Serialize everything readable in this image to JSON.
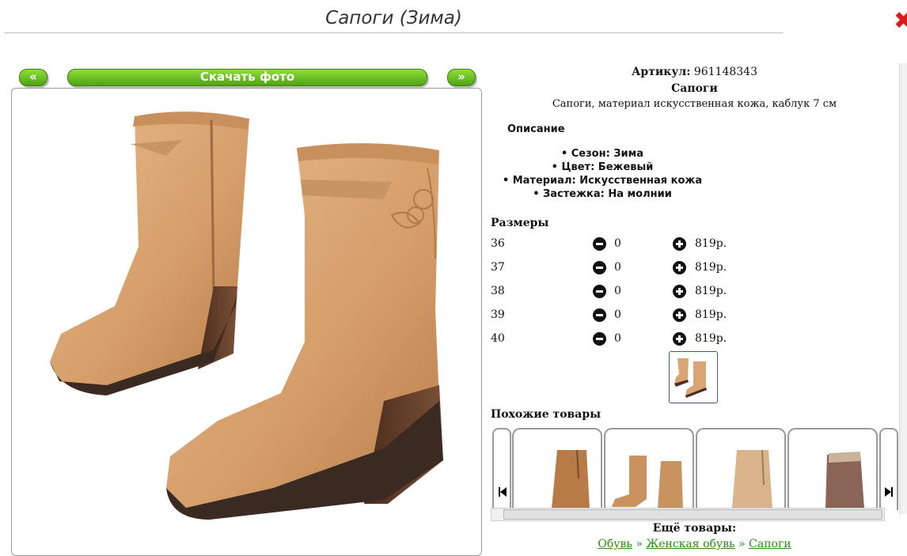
{
  "page": {
    "title": "Сапоги (Зима)"
  },
  "gallery": {
    "prev_label": "«",
    "download_label": "Скачать фото",
    "next_label": "»"
  },
  "product": {
    "article_label": "Артикул:",
    "article_value": "961148343",
    "name": "Сапоги",
    "short_desc": "Сапоги, материал искусственная кожа, каблук 7 см",
    "description_heading": "Описание",
    "features": [
      "• Сезон: Зима",
      "• Цвет: Бежевый",
      "• Материал: Искусственная кожа",
      "• Застежка: На молнии"
    ]
  },
  "sizes": {
    "heading": "Размеры",
    "rows": [
      {
        "size": "36",
        "qty": "0",
        "price": "819р."
      },
      {
        "size": "37",
        "qty": "0",
        "price": "819р."
      },
      {
        "size": "38",
        "qty": "0",
        "price": "819р."
      },
      {
        "size": "39",
        "qty": "0",
        "price": "819р."
      },
      {
        "size": "40",
        "qty": "0",
        "price": "819р."
      }
    ]
  },
  "similar": {
    "heading": "Похожие товары"
  },
  "more": {
    "heading": "Ещё товары:",
    "crumbs": [
      "Обувь",
      "Женская обувь",
      "Сапоги"
    ],
    "separator": "»"
  },
  "colors": {
    "button_green": "#5cb41e",
    "close_red": "#d81c1c",
    "link_green": "#2d8a14"
  }
}
